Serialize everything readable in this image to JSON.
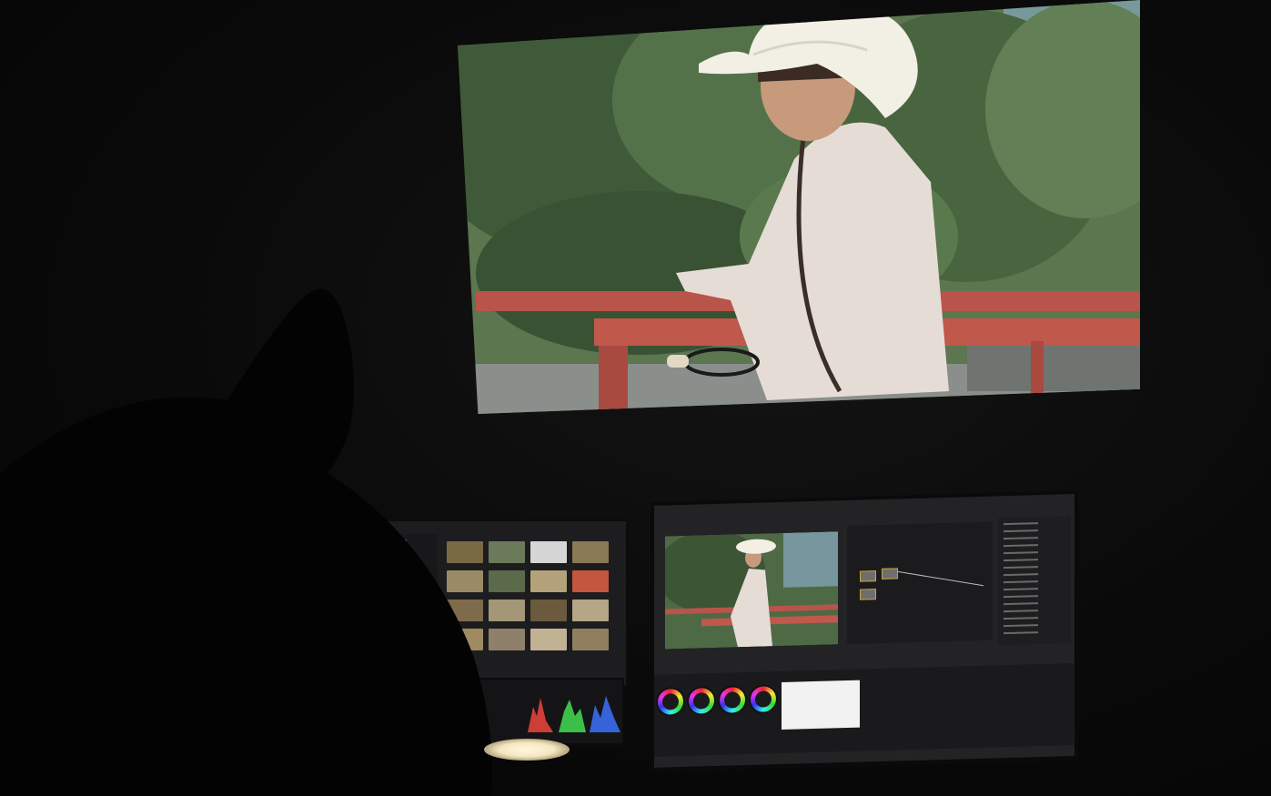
{
  "scene": {
    "description_tags": [
      "color-grading-suite",
      "projection-screen",
      "editing-monitors"
    ],
    "colors": {
      "sky": "#8fb6d8",
      "foliage": "#4f6b45",
      "railing": "#b9544a",
      "shirt": "#e6dcd6",
      "hat": "#f2efe4",
      "room": "#070707"
    }
  },
  "icons": [
    "color-wheel-icon",
    "desk-lamp-icon"
  ]
}
